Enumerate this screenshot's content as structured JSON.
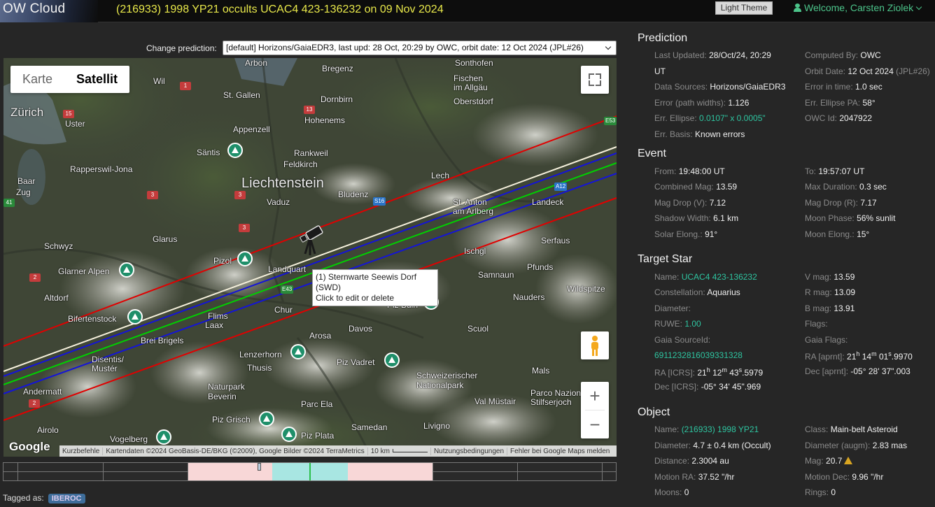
{
  "header": {
    "brand": "OW Cloud",
    "title": "(216933) 1998 YP21 occults UCAC4 423-136232 on 09 Nov 2024",
    "theme_button": "Light Theme",
    "welcome": "Welcome, Carsten Ziolek"
  },
  "prediction_select": {
    "label": "Change prediction:",
    "value": "[default] Horizons/GaiaEDR3, last upd: 28 Oct, 20:29 by OWC, orbit date: 12 Oct 2024 (JPL#26)"
  },
  "map": {
    "map_type": {
      "map": "Karte",
      "satellite": "Satellit",
      "selected": "Satellit"
    },
    "zoom_in": "+",
    "zoom_out": "−",
    "tooltip_line1": "(1) Sternwarte Seewis Dorf (SWD)",
    "tooltip_line2": "Click to edit or delete",
    "google_logo": "Google",
    "attribution": {
      "shortcuts": "Kurzbefehle",
      "data": "Kartendaten ©2024 GeoBasis-DE/BKG (©2009), Google Bilder ©2024 TerraMetrics",
      "scale": "10 km",
      "terms": "Nutzungsbedingungen",
      "report": "Fehler bei Google Maps melden"
    },
    "places": {
      "zurich": "Zürich",
      "uster": "Uster",
      "baar": "Baar",
      "zug": "Zug",
      "rapperswil": "Rapperswil-Jona",
      "schwyz": "Schwyz",
      "glarner": "Glarner Alpen",
      "altdorf": "Altdorf",
      "bifertenstock": "Bifertenstock",
      "brei": "Brei Brigels",
      "disentis": "Disentis/\nMustér",
      "andermatt": "Andermatt",
      "airolo": "Airolo",
      "vogelberg": "Vogelberg",
      "arbon": "Arbon",
      "stgallen": "St. Gallen",
      "appenzell": "Appenzell",
      "santis": "Säntis",
      "wil": "Wil",
      "bregenz": "Bregenz",
      "dornbirn": "Dornbirn",
      "hohenems": "Hohenems",
      "rankweil": "Rankweil",
      "feldkirch": "Feldkirch",
      "liechtenstein": "Liechtenstein",
      "vaduz": "Vaduz",
      "bludenz": "Bludenz",
      "sonthofen": "Sonthofen",
      "fischen": "Fischen\nim Allgäu",
      "oberstdorf": "Oberstdorf",
      "lech": "Lech",
      "stanton": "St. Anton\nam Arlberg",
      "landeck": "Landeck",
      "ischgl": "Ischgl",
      "serfaus": "Serfaus",
      "samnaun": "Samnaun",
      "pfunds": "Pfunds",
      "nauders": "Nauders",
      "wildspitze": "Wildspitze",
      "glarus": "Glarus",
      "pizol": "Pizol",
      "landquart": "Landquart",
      "chur": "Chur",
      "flims": "Flims",
      "laax": "Laax",
      "piz_buin": "Piz Buin",
      "davos": "Davos",
      "scuol": "Scuol",
      "arosa": "Arosa",
      "lenzerhorn": "Lenzerhorn",
      "thusis": "Thusis",
      "piz_vadret": "Piz Vadret",
      "mals": "Mals",
      "nationalpark": "Schweizerischer\nNationalpark",
      "naturpark": "Naturpark\nBeverin",
      "val_mustair": "Val Müstair",
      "stilfserjoch": "Parco Nazionale\nStilfserjoch",
      "parc_ela": "Parc Ela",
      "piz_grisch": "Piz Grisch",
      "piz_plata": "Piz Plata",
      "samedan": "Samedan",
      "livigno": "Livigno"
    },
    "roads": [
      "15",
      "1",
      "13",
      "3",
      "3",
      "3",
      "2",
      "2",
      "41",
      "S16",
      "A12",
      "E53",
      "E43"
    ]
  },
  "timeline": {
    "present": true
  },
  "tags": {
    "label": "Tagged as:",
    "items": [
      "IBEROC"
    ]
  },
  "panel": {
    "prediction": {
      "title": "Prediction",
      "last_updated_k": "Last Updated:",
      "last_updated_v": "28/Oct/24, 20:29",
      "last_updated_v2": "UT",
      "computed_by_k": "Computed By:",
      "computed_by_v": "OWC",
      "orbit_date_k": "Orbit Date:",
      "orbit_date_v": "12 Oct 2024",
      "orbit_date_muted": "(JPL#26)",
      "data_sources_k": "Data Sources:",
      "data_sources_v": "Horizons/GaiaEDR3",
      "error_time_k": "Error in time:",
      "error_time_v": "1.0 sec",
      "error_path_k": "Error (path widths):",
      "error_path_v": "1.126",
      "err_ellipse_pa_k": "Err. Ellipse PA:",
      "err_ellipse_pa_v": "58°",
      "err_ellipse_k": "Err. Ellipse:",
      "err_ellipse_v": "0.0107\" x 0.0005\"",
      "owc_id_k": "OWC Id:",
      "owc_id_v": "2047922",
      "err_basis_k": "Err. Basis:",
      "err_basis_v": "Known errors"
    },
    "event": {
      "title": "Event",
      "from_k": "From:",
      "from_v": "19:48:00 UT",
      "to_k": "To:",
      "to_v": "19:57:07 UT",
      "comb_mag_k": "Combined Mag:",
      "comb_mag_v": "13.59",
      "max_dur_k": "Max Duration:",
      "max_dur_v": "0.3 sec",
      "mag_drop_v_k": "Mag Drop (V):",
      "mag_drop_v_v": "7.12",
      "mag_drop_r_k": "Mag Drop (R):",
      "mag_drop_r_v": "7.17",
      "shadow_k": "Shadow Width:",
      "shadow_v": "6.1 km",
      "moon_phase_k": "Moon Phase:",
      "moon_phase_v": "56% sunlit",
      "solar_elong_k": "Solar Elong.:",
      "solar_elong_v": "91°",
      "moon_elong_k": "Moon Elong.:",
      "moon_elong_v": "15°"
    },
    "target_star": {
      "title": "Target Star",
      "name_k": "Name:",
      "name_v": "UCAC4 423-136232",
      "vmag_k": "V mag:",
      "vmag_v": "13.59",
      "const_k": "Constellation:",
      "const_v": "Aquarius",
      "rmag_k": "R mag:",
      "rmag_v": "13.09",
      "diam_k": "Diameter:",
      "bmag_k": "B mag:",
      "bmag_v": "13.91",
      "ruwe_k": "RUWE:",
      "ruwe_v": "1.00",
      "flags_k": "Flags:",
      "gaia_src_k": "Gaia SourceId:",
      "gaia_src_v": "6911232816039331328",
      "gaia_flags_k": "Gaia Flags:",
      "ra_aprnt_k": "RA [aprnt]:",
      "ra_aprnt_v": "21h 14m 01s.9970",
      "ra_icrs_k": "RA [ICRS]:",
      "ra_icrs_v": "21h 12m 43s.5979",
      "dec_aprnt_k": "Dec [aprnt]:",
      "dec_aprnt_v": "-05° 28' 37\".003",
      "dec_icrs_k": "Dec [ICRS]:",
      "dec_icrs_v": "-05° 34' 45\".969"
    },
    "object": {
      "title": "Object",
      "name_k": "Name:",
      "name_v": "(216933) 1998 YP21",
      "class_k": "Class:",
      "class_v": "Main-belt Asteroid",
      "diam_k": "Diameter:",
      "diam_v": "4.7 ± 0.4 km",
      "diam_muted": "(Occult)",
      "diam_augm_k": "Diameter (augm):",
      "diam_augm_v": "2.83 mas",
      "dist_k": "Distance:",
      "dist_v": "2.3004 au",
      "mag_k": "Mag:",
      "mag_v": "20.7",
      "mra_k": "Motion RA:",
      "mra_v": "37.52 \"/hr",
      "mdec_k": "Motion Dec:",
      "mdec_v": "9.96 \"/hr",
      "moons_k": "Moons:",
      "moons_v": "0",
      "rings_k": "Rings:",
      "rings_v": "0"
    }
  }
}
